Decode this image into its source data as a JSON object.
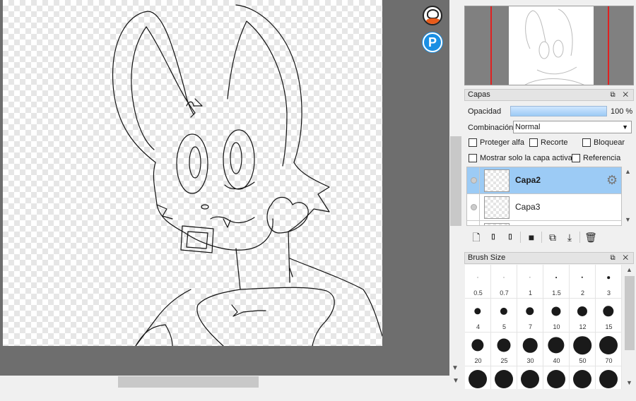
{
  "layers_panel": {
    "title": "Capas",
    "opacity_label": "Opacidad",
    "opacity_value": "100 %",
    "opacity_fraction": 1.0,
    "blend_label": "Combinación",
    "blend_value": "Normal",
    "checkboxes": {
      "protect_alpha": "Proteger alfa",
      "clipping": "Recorte",
      "lock": "Bloquear",
      "show_active_only": "Mostrar solo la capa activa",
      "reference": "Referencia"
    },
    "layers": [
      {
        "name": "Capa2",
        "active": true
      },
      {
        "name": "Capa3",
        "active": false
      }
    ]
  },
  "brush_panel": {
    "title": "Brush Size",
    "sizes": [
      "0.5",
      "0.7",
      "1",
      "1.5",
      "2",
      "3",
      "4",
      "5",
      "7",
      "10",
      "12",
      "15",
      "20",
      "25",
      "30",
      "40",
      "50",
      "70",
      "",
      "",
      "",
      "",
      "",
      ""
    ]
  },
  "window_buttons": "⧉ ✕",
  "icons": {
    "layer_tools": [
      "new-layer-icon",
      "new-8bit-layer-icon",
      "new-1bit-layer-icon",
      "new-folder-icon",
      "duplicate-layer-icon",
      "merge-down-icon",
      "delete-layer-icon"
    ],
    "app_icon_2_glyph": "P"
  },
  "colors": {
    "workspace": "#6e6e6e",
    "active_layer": "#9ccbf5",
    "navigator_bounds": "#e02020",
    "app_icon_2": "#1a8fe3"
  }
}
